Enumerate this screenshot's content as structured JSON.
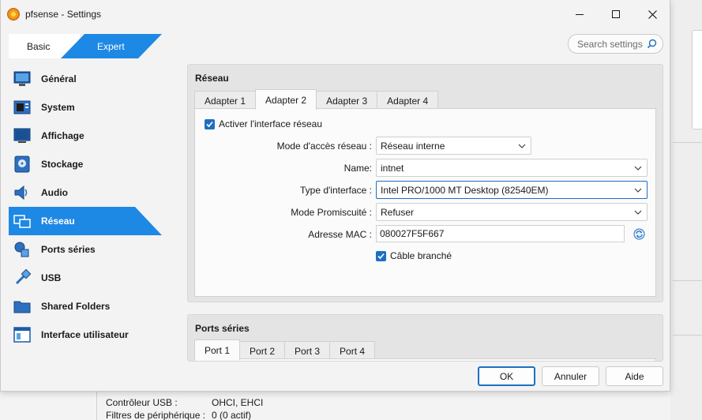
{
  "window": {
    "title": "pfsense - Settings"
  },
  "mode_tabs": {
    "basic": "Basic",
    "expert": "Expert"
  },
  "search": {
    "placeholder": "Search settings"
  },
  "sidebar": {
    "items": [
      {
        "label": "Général",
        "icon": "general-icon"
      },
      {
        "label": "System",
        "icon": "system-icon"
      },
      {
        "label": "Affichage",
        "icon": "display-icon"
      },
      {
        "label": "Stockage",
        "icon": "storage-icon"
      },
      {
        "label": "Audio",
        "icon": "audio-icon"
      },
      {
        "label": "Réseau",
        "icon": "network-icon",
        "active": true
      },
      {
        "label": "Ports séries",
        "icon": "serial-ports-icon"
      },
      {
        "label": "USB",
        "icon": "usb-icon"
      },
      {
        "label": "Shared Folders",
        "icon": "shared-folders-icon"
      },
      {
        "label": "Interface utilisateur",
        "icon": "user-interface-icon"
      }
    ]
  },
  "network": {
    "title": "Réseau",
    "tabs": [
      "Adapter 1",
      "Adapter 2",
      "Adapter 3",
      "Adapter 4"
    ],
    "active_tab": "Adapter 2",
    "enable_label": "Activer l'interface réseau",
    "enable_checked": true,
    "attached_label": "Mode d'accès réseau :",
    "attached_value": "Réseau interne",
    "name_label": "Name:",
    "name_value": "intnet",
    "type_label": "Type d'interface :",
    "type_value": "Intel PRO/1000 MT Desktop (82540EM)",
    "promisc_label": "Mode Promiscuité :",
    "promisc_value": "Refuser",
    "mac_label": "Adresse MAC :",
    "mac_value": "080027F5F667",
    "cable_label": "Câble branché",
    "cable_checked": true
  },
  "serial": {
    "title": "Ports séries",
    "tabs": [
      "Port 1",
      "Port 2",
      "Port 3",
      "Port 4"
    ],
    "active_tab": "Port 1"
  },
  "buttons": {
    "ok": "OK",
    "cancel": "Annuler",
    "help": "Aide"
  },
  "background": {
    "usb_label": "Contrôleur USB :",
    "usb_value": "OHCI, EHCI",
    "filters_label": "Filtres de périphérique :",
    "filters_value": "0 (0 actif)"
  },
  "colors": {
    "accent": "#1e88e5",
    "checkbox": "#1e6fc2"
  }
}
